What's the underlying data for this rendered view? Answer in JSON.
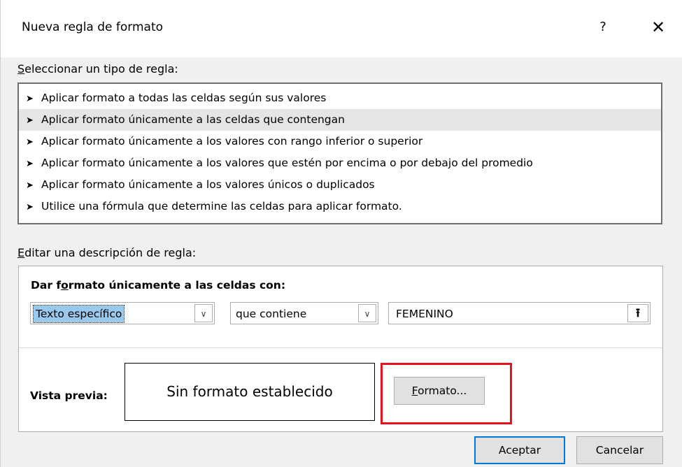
{
  "dialog": {
    "title": "Nueva regla de formato",
    "help_label": "?",
    "close_label": "✕"
  },
  "rule_type": {
    "label_accel": "S",
    "label_rest": "eleccionar un tipo de regla:",
    "arrow": "➤",
    "items": [
      {
        "label": "Aplicar formato a todas las celdas según sus valores",
        "selected": false
      },
      {
        "label": "Aplicar formato únicamente a las celdas que contengan",
        "selected": true
      },
      {
        "label": "Aplicar formato únicamente a los valores con rango inferior o superior",
        "selected": false
      },
      {
        "label": "Aplicar formato únicamente a los valores que estén por encima o por debajo del promedio",
        "selected": false
      },
      {
        "label": "Aplicar formato únicamente a los valores únicos o duplicados",
        "selected": false
      },
      {
        "label": "Utilice una fórmula que determine las celdas para aplicar formato.",
        "selected": false
      }
    ]
  },
  "description": {
    "label_accel": "E",
    "label_rest": "ditar una descripción de regla:",
    "heading_pre": "Dar f",
    "heading_accel": "o",
    "heading_post": "rmato únicamente a las celdas con:",
    "condition_type": "Texto específico",
    "operator": "que contiene",
    "value": "FEMENINO",
    "preview_label": "Vista previa:",
    "preview_text": "Sin formato establecido",
    "format_accel": "F",
    "format_rest": "ormato..."
  },
  "footer": {
    "ok_label": "Aceptar",
    "cancel_label": "Cancelar"
  },
  "colors": {
    "highlight_border": "#e8121e",
    "selection_bg": "#99c9ef",
    "primary_button_border": "#0078d7"
  }
}
